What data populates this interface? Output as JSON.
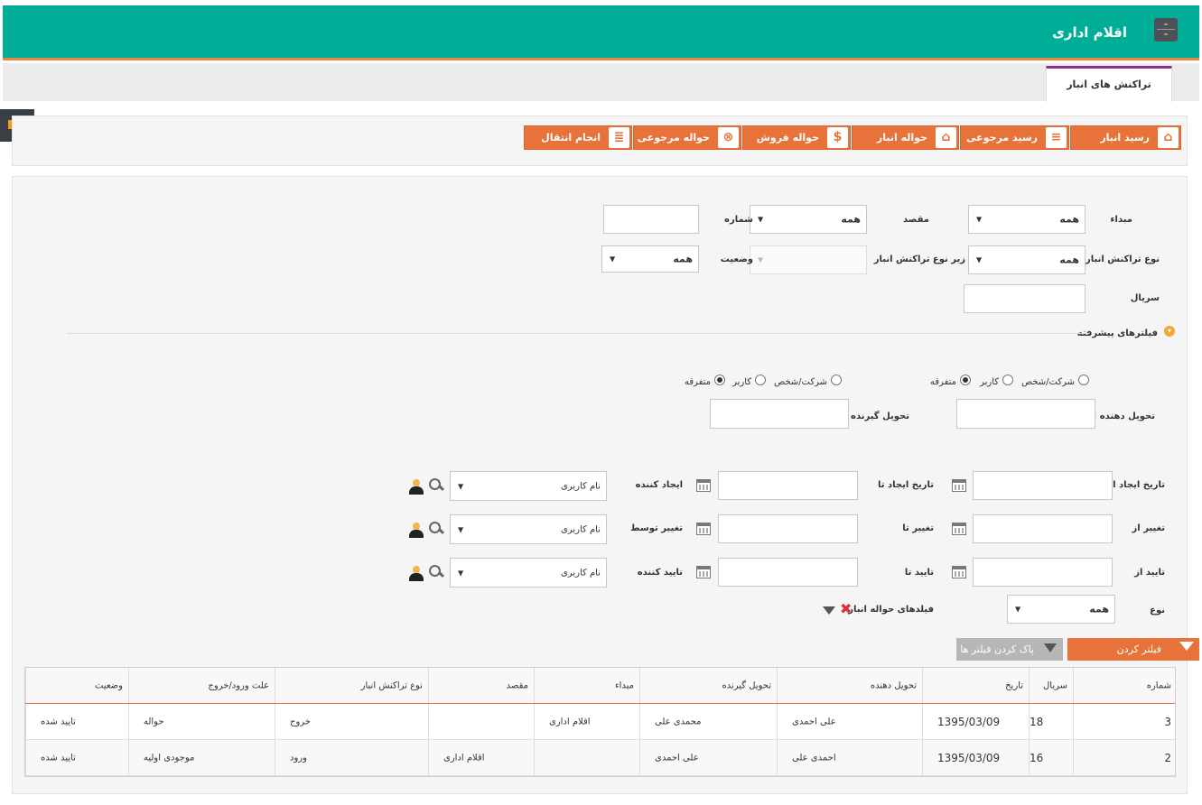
{
  "header": {
    "title": "اقلام اداری"
  },
  "tabs": [
    {
      "label": "تراکنش های انبار"
    }
  ],
  "toolbar": {
    "buttons": [
      {
        "label": "رسید انبار",
        "icon": "warehouse-receipt-icon"
      },
      {
        "label": "رسید مرجوعی",
        "icon": "return-receipt-icon"
      },
      {
        "label": "حواله انبار",
        "icon": "warehouse-transfer-icon"
      },
      {
        "label": "حواله فروش",
        "icon": "dollar-icon"
      },
      {
        "label": "حواله مرجوعی",
        "icon": "cart-return-icon"
      },
      {
        "label": "انجام انتقال",
        "icon": "document-transfer-icon"
      }
    ]
  },
  "filters": {
    "source": {
      "label": "مبداء",
      "value": "همه"
    },
    "destination": {
      "label": "مقصد",
      "value": "همه"
    },
    "number": {
      "label": "شماره",
      "value": ""
    },
    "transaction_type": {
      "label": "نوع تراکنش انبار",
      "value": "همه"
    },
    "sub_transaction_type": {
      "label": "زیر نوع تراکنش انبار",
      "value": ""
    },
    "status": {
      "label": "وضعیت",
      "value": "همه"
    },
    "serial": {
      "label": "سریال",
      "value": ""
    }
  },
  "advanced": {
    "toggle_label": "فیلترهای پیشرفته",
    "deliverer_label": "تحویل دهنده :",
    "receiver_label": "تحویل گیرنده :",
    "radio_options": [
      "شرکت/شخص",
      "کاربر",
      "متفرقه"
    ],
    "deliverer_selected": "متفرقه",
    "receiver_selected": "متفرقه",
    "created_from_label": "تاریخ ایجاد از",
    "created_to_label": "تاریخ ایجاد تا",
    "creator_label": "ایجاد کننده",
    "changed_from_label": "تغییر از",
    "changed_to_label": "تغییر تا",
    "changed_by_label": "تغییر توسط",
    "approved_from_label": "تایید از",
    "approved_to_label": "تایید تا",
    "approver_label": "تایید کننده",
    "username_placeholder": "نام کاربری",
    "type_label": "نوع",
    "type_value": "همه",
    "transfer_fields_label": "فیلدهای حواله انبار"
  },
  "actions": {
    "filter_label": "فیلتر کردن",
    "clear_label": "پاک کردن فیلتر ها"
  },
  "table": {
    "columns": [
      "شماره",
      "سریال",
      "تاریخ",
      "تحویل دهنده",
      "تحویل گیرنده",
      "مبداء",
      "مقصد",
      "نوع تراکنش انبار",
      "علت ورود/خروج",
      "وضعیت"
    ],
    "rows": [
      [
        "3",
        "18",
        "1395/03/09",
        "علی احمدی",
        "محمدی علی",
        "اقلام اداری",
        "",
        "خروج",
        "حواله",
        "تایید شده"
      ],
      [
        "2",
        "16",
        "1395/03/09",
        "احمدی علی",
        "علی احمدی",
        "",
        "اقلام اداری",
        "ورود",
        "موجودی اولیه",
        "تایید شده"
      ]
    ]
  },
  "colors": {
    "header": "#00ad96",
    "accent": "#e8733a",
    "tab_border": "#8e2f8f"
  }
}
